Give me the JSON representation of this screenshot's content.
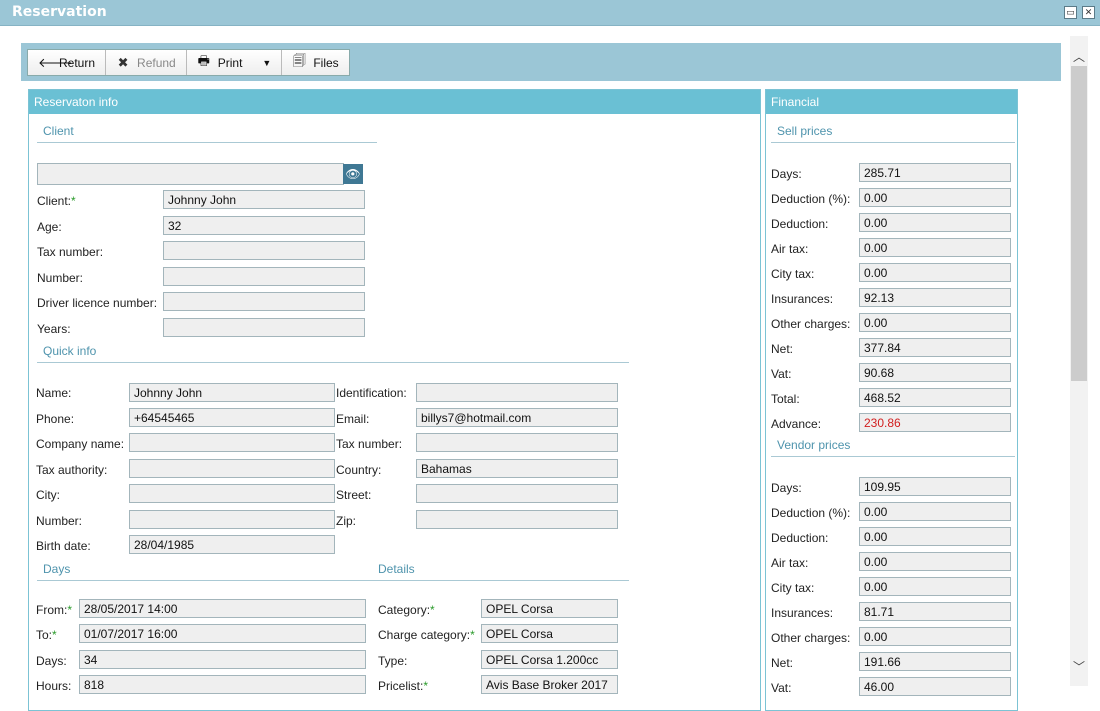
{
  "window": {
    "title": "Reservation",
    "restore_icon": "restore-icon",
    "close_icon": "close-icon"
  },
  "toolbar": {
    "return_label": "Return",
    "refund_label": "Refund",
    "print_label": "Print",
    "files_label": "Files"
  },
  "reservation": {
    "header": "Reservaton info",
    "client_section": "Client",
    "client_search_value": "",
    "client": {
      "label": "Client:",
      "value": "Johnny John"
    },
    "age": {
      "label": "Age:",
      "value": "32"
    },
    "tax_number": {
      "label": "Tax number:",
      "value": ""
    },
    "number": {
      "label": "Number:",
      "value": ""
    },
    "driver_licence": {
      "label": "Driver licence number:",
      "value": ""
    },
    "years": {
      "label": "Years:",
      "value": ""
    },
    "quick_info_section": "Quick info",
    "quick": {
      "name": {
        "label": "Name:",
        "value": "Johnny John"
      },
      "phone": {
        "label": "Phone:",
        "value": "+64545465"
      },
      "company_name": {
        "label": "Company name:",
        "value": ""
      },
      "tax_authority": {
        "label": "Tax authority:",
        "value": ""
      },
      "city": {
        "label": "City:",
        "value": ""
      },
      "number": {
        "label": "Number:",
        "value": ""
      },
      "birth_date": {
        "label": "Birth date:",
        "value": "28/04/1985"
      },
      "identification": {
        "label": "Identification:",
        "value": ""
      },
      "email": {
        "label": "Email:",
        "value": "billys7@hotmail.com"
      },
      "tax_number": {
        "label": "Tax number:",
        "value": ""
      },
      "country": {
        "label": "Country:",
        "value": "Bahamas"
      },
      "street": {
        "label": "Street:",
        "value": ""
      },
      "zip": {
        "label": "Zip:",
        "value": ""
      }
    },
    "days_section": "Days",
    "days": {
      "from": {
        "label": "From:",
        "value": "28/05/2017 14:00"
      },
      "to": {
        "label": "To:",
        "value": "01/07/2017 16:00"
      },
      "days": {
        "label": "Days:",
        "value": "34"
      },
      "hours": {
        "label": "Hours:",
        "value": "818"
      }
    },
    "details_section": "Details",
    "details": {
      "category": {
        "label": "Category:",
        "value": "OPEL Corsa"
      },
      "charge_category": {
        "label": "Charge category:",
        "value": "OPEL Corsa"
      },
      "type": {
        "label": "Type:",
        "value": "OPEL Corsa 1.200cc"
      },
      "pricelist": {
        "label": "Pricelist:",
        "value": "Avis Base Broker 2017"
      }
    }
  },
  "financial": {
    "header": "Financial",
    "sell_section": "Sell prices",
    "sell": [
      {
        "label": "Days:",
        "value": "285.71"
      },
      {
        "label": "Deduction (%):",
        "value": "0.00"
      },
      {
        "label": "Deduction:",
        "value": "0.00"
      },
      {
        "label": "Air tax:",
        "value": "0.00"
      },
      {
        "label": "City tax:",
        "value": "0.00"
      },
      {
        "label": "Insurances:",
        "value": "92.13"
      },
      {
        "label": "Other charges:",
        "value": "0.00"
      },
      {
        "label": "Net:",
        "value": "377.84"
      },
      {
        "label": "Vat:",
        "value": "90.68"
      },
      {
        "label": "Total:",
        "value": "468.52"
      },
      {
        "label": "Advance:",
        "value": "230.86",
        "highlight_color": "#d21f1f"
      }
    ],
    "vendor_section": "Vendor prices",
    "vendor": [
      {
        "label": "Days:",
        "value": "109.95"
      },
      {
        "label": "Deduction (%):",
        "value": "0.00"
      },
      {
        "label": "Deduction:",
        "value": "0.00"
      },
      {
        "label": "Air tax:",
        "value": "0.00"
      },
      {
        "label": "City tax:",
        "value": "0.00"
      },
      {
        "label": "Insurances:",
        "value": "81.71"
      },
      {
        "label": "Other charges:",
        "value": "0.00"
      },
      {
        "label": "Net:",
        "value": "191.66"
      },
      {
        "label": "Vat:",
        "value": "46.00"
      }
    ]
  },
  "colors": {
    "title_bar": "#9bc6d6",
    "panel_header": "#6ac0d4",
    "required_mark": "#2a9a2a"
  }
}
